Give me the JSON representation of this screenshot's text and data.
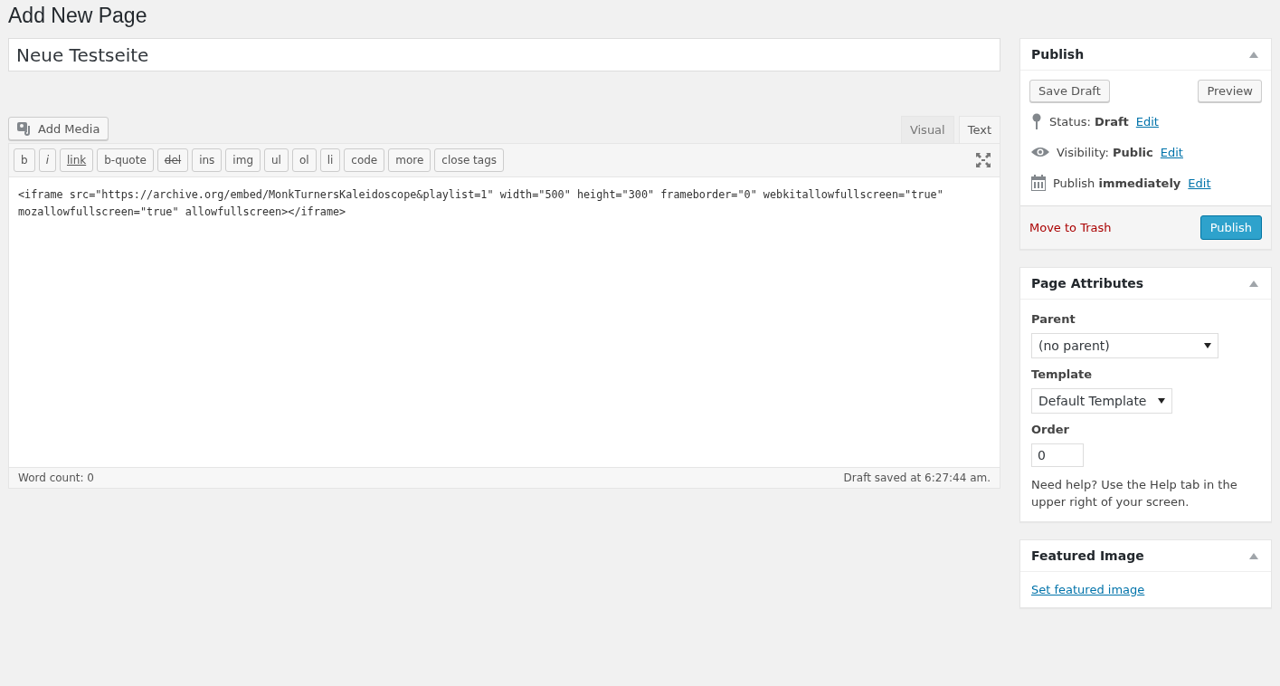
{
  "page_title": "Add New Page",
  "title_field": {
    "value": "Neue Testseite"
  },
  "add_media": {
    "label": "Add Media"
  },
  "editor": {
    "tabs": [
      {
        "label": "Visual",
        "selected": false
      },
      {
        "label": "Text",
        "selected": true
      }
    ],
    "quicktags": [
      {
        "label": "b",
        "kind": "bold"
      },
      {
        "label": "i",
        "kind": "italic"
      },
      {
        "label": "link",
        "kind": "link"
      },
      {
        "label": "b-quote",
        "kind": "plain"
      },
      {
        "label": "del",
        "kind": "strike"
      },
      {
        "label": "ins",
        "kind": "plain"
      },
      {
        "label": "img",
        "kind": "plain"
      },
      {
        "label": "ul",
        "kind": "plain"
      },
      {
        "label": "ol",
        "kind": "plain"
      },
      {
        "label": "li",
        "kind": "plain"
      },
      {
        "label": "code",
        "kind": "plain"
      },
      {
        "label": "more",
        "kind": "plain"
      },
      {
        "label": "close tags",
        "kind": "plain"
      }
    ],
    "content": "<iframe src=\"https://archive.org/embed/MonkTurnersKaleidoscope&playlist=1\" width=\"500\" height=\"300\" frameborder=\"0\" webkitallowfullscreen=\"true\" mozallowfullscreen=\"true\" allowfullscreen></iframe>",
    "word_count": "Word count: 0",
    "draft_saved": "Draft saved at 6:27:44 am."
  },
  "publish_box": {
    "title": "Publish",
    "save_draft": "Save Draft",
    "preview": "Preview",
    "rows": [
      {
        "kind": "status",
        "text": "Status: **Draft**",
        "link": "Edit"
      },
      {
        "kind": "visibility",
        "text": "Visibility: **Public**",
        "link": "Edit"
      },
      {
        "kind": "schedule",
        "text": "Publish **immediately**",
        "link": "Edit"
      }
    ],
    "trash": "Move to Trash",
    "publish": "Publish"
  },
  "attributes_box": {
    "title": "Page Attributes",
    "parent_label": "Parent",
    "parent_value": "(no parent)",
    "template_label": "Template",
    "template_value": "Default Template",
    "order_label": "Order",
    "order_value": "0",
    "help": "Need help? Use the Help tab in the upper right of your screen."
  },
  "featured_box": {
    "title": "Featured Image",
    "link": "Set featured image"
  }
}
